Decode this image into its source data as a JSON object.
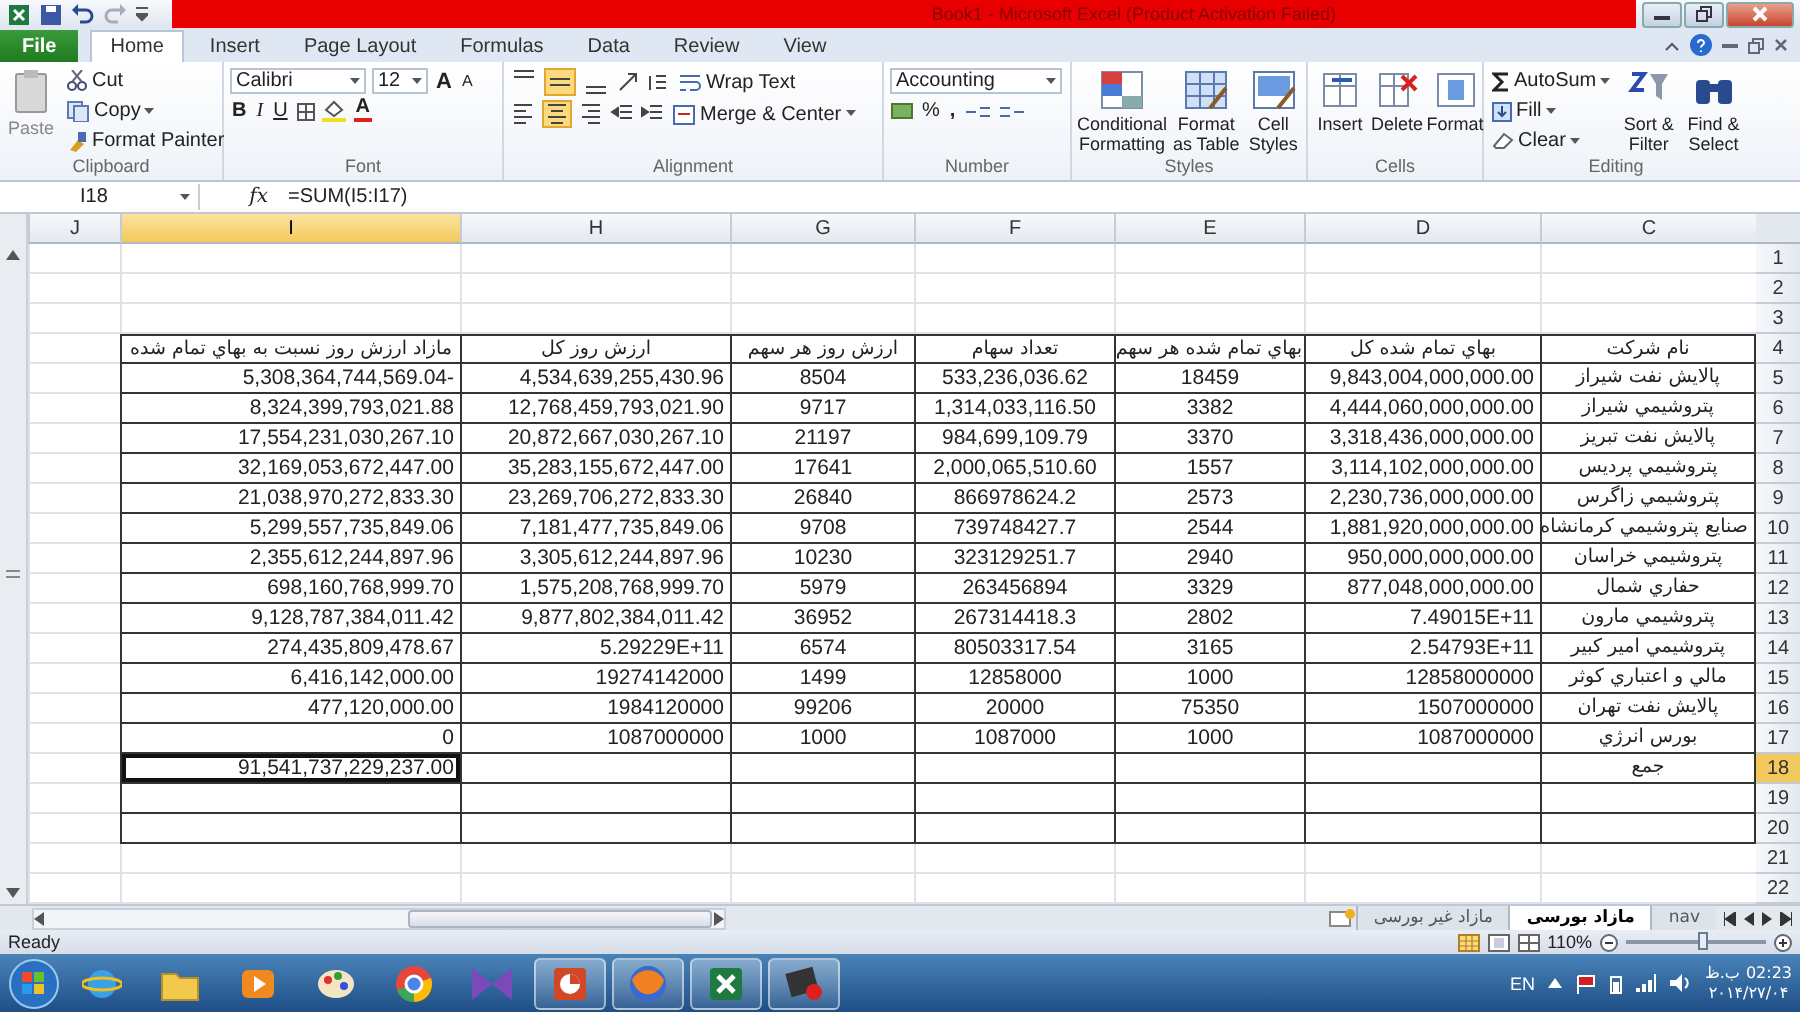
{
  "window": {
    "title": "Book1  -  Microsoft Excel (Product Activation Failed)"
  },
  "ribbon_tabs": [
    {
      "label": "File",
      "kind": "file",
      "selected": false
    },
    {
      "label": "Home",
      "kind": "tab",
      "selected": true
    },
    {
      "label": "Insert",
      "kind": "tab",
      "selected": false
    },
    {
      "label": "Page Layout",
      "kind": "tab",
      "selected": false
    },
    {
      "label": "Formulas",
      "kind": "tab",
      "selected": false
    },
    {
      "label": "Data",
      "kind": "tab",
      "selected": false
    },
    {
      "label": "Review",
      "kind": "tab",
      "selected": false
    },
    {
      "label": "View",
      "kind": "tab",
      "selected": false
    }
  ],
  "ribbon": {
    "clipboard": {
      "paste": "Paste",
      "cut": "Cut",
      "copy": "Copy",
      "format_painter": "Format Painter",
      "label": "Clipboard"
    },
    "font": {
      "font_name": "Calibri",
      "font_size": "12",
      "grow": "A",
      "shrink": "A",
      "bold": "B",
      "italic": "I",
      "underline": "U",
      "font_color": "A",
      "label": "Font"
    },
    "alignment": {
      "vertical": [
        {
          "selected": false
        },
        {
          "selected": true
        },
        {
          "selected": false
        }
      ],
      "horizontal": [
        {
          "selected": false
        },
        {
          "selected": true
        },
        {
          "selected": false
        }
      ],
      "wrap_text": "Wrap Text",
      "merge": "Merge & Center",
      "label": "Alignment"
    },
    "number": {
      "format": "Accounting",
      "percent": "%",
      "comma": ",",
      "label": "Number"
    },
    "styles": {
      "buttons": [
        "Conditional Formatting",
        "Format as Table",
        "Cell Styles"
      ],
      "label": "Styles"
    },
    "cells": {
      "buttons": [
        "Insert",
        "Delete",
        "Format"
      ],
      "label": "Cells"
    },
    "editing": {
      "autosum": "AutoSum",
      "fill": "Fill",
      "clear": "Clear",
      "buttons": [
        "Sort & Filter",
        "Find & Select"
      ],
      "label": "Editing"
    }
  },
  "formula_bar": {
    "name_box": "I18",
    "function_label": "fx",
    "formula": "=SUM(I5:I17)"
  },
  "sheet": {
    "columns": [
      {
        "label": "J",
        "selected": false
      },
      {
        "label": "I",
        "selected": true
      },
      {
        "label": "H",
        "selected": false
      },
      {
        "label": "G",
        "selected": false
      },
      {
        "label": "F",
        "selected": false
      },
      {
        "label": "E",
        "selected": false
      },
      {
        "label": "D",
        "selected": false
      },
      {
        "label": "C",
        "selected": false
      }
    ],
    "row_numbers": [
      {
        "label": "1",
        "selected": false
      },
      {
        "label": "2",
        "selected": false
      },
      {
        "label": "3",
        "selected": false
      },
      {
        "label": "4",
        "selected": false
      },
      {
        "label": "5",
        "selected": false
      },
      {
        "label": "6",
        "selected": false
      },
      {
        "label": "7",
        "selected": false
      },
      {
        "label": "8",
        "selected": false
      },
      {
        "label": "9",
        "selected": false
      },
      {
        "label": "10",
        "selected": false
      },
      {
        "label": "11",
        "selected": false
      },
      {
        "label": "12",
        "selected": false
      },
      {
        "label": "13",
        "selected": false
      },
      {
        "label": "14",
        "selected": false
      },
      {
        "label": "15",
        "selected": false
      },
      {
        "label": "16",
        "selected": false
      },
      {
        "label": "17",
        "selected": false
      },
      {
        "label": "18",
        "selected": true
      },
      {
        "label": "19",
        "selected": false
      },
      {
        "label": "20",
        "selected": false
      },
      {
        "label": "21",
        "selected": false
      },
      {
        "label": "22",
        "selected": false
      }
    ],
    "table": {
      "header": {
        "company": "نام شرکت",
        "total_cost": "بهاي تمام شده کل",
        "cost_per_share": "بهاي تمام شده هر سهم",
        "shares": "تعداد سهام",
        "value_per_share": "ارزش روز هر سهم",
        "total_value": "ارزش روز کل",
        "surplus": "مازاد ارزش روز نسبت به بهاي تمام شده"
      },
      "rows": [
        {
          "company": "پالایش نفت شیراز",
          "total_cost": "9,843,004,000,000.00",
          "cost_per_share": "18459",
          "shares": "533,236,036.62",
          "value_per_share": "8504",
          "total_value": "4,534,639,255,430.96",
          "surplus": "5,308,364,744,569.04-"
        },
        {
          "company": "پتروشیمي شیراز",
          "total_cost": "4,444,060,000,000.00",
          "cost_per_share": "3382",
          "shares": "1,314,033,116.50",
          "value_per_share": "9717",
          "total_value": "12,768,459,793,021.90",
          "surplus": "8,324,399,793,021.88"
        },
        {
          "company": "پالایش نفت تبریز",
          "total_cost": "3,318,436,000,000.00",
          "cost_per_share": "3370",
          "shares": "984,699,109.79",
          "value_per_share": "21197",
          "total_value": "20,872,667,030,267.10",
          "surplus": "17,554,231,030,267.10"
        },
        {
          "company": "پتروشیمي پردیس",
          "total_cost": "3,114,102,000,000.00",
          "cost_per_share": "1557",
          "shares": "2,000,065,510.60",
          "value_per_share": "17641",
          "total_value": "35,283,155,672,447.00",
          "surplus": "32,169,053,672,447.00"
        },
        {
          "company": "پتروشیمي زاگرس",
          "total_cost": "2,230,736,000,000.00",
          "cost_per_share": "2573",
          "shares": "866978624.2",
          "value_per_share": "26840",
          "total_value": "23,269,706,272,833.30",
          "surplus": "21,038,970,272,833.30"
        },
        {
          "company": "صنایع پتروشیمي کرمانشاه",
          "total_cost": "1,881,920,000,000.00",
          "cost_per_share": "2544",
          "shares": "739748427.7",
          "value_per_share": "9708",
          "total_value": "7,181,477,735,849.06",
          "surplus": "5,299,557,735,849.06"
        },
        {
          "company": "پتروشیمي خراسان",
          "total_cost": "950,000,000,000.00",
          "cost_per_share": "2940",
          "shares": "323129251.7",
          "value_per_share": "10230",
          "total_value": "3,305,612,244,897.96",
          "surplus": "2,355,612,244,897.96"
        },
        {
          "company": "حفاري شمال",
          "total_cost": "877,048,000,000.00",
          "cost_per_share": "3329",
          "shares": "263456894",
          "value_per_share": "5979",
          "total_value": "1,575,208,768,999.70",
          "surplus": "698,160,768,999.70"
        },
        {
          "company": "پتروشیمي مارون",
          "total_cost": "7.49015E+11",
          "cost_per_share": "2802",
          "shares": "267314418.3",
          "value_per_share": "36952",
          "total_value": "9,877,802,384,011.42",
          "surplus": "9,128,787,384,011.42"
        },
        {
          "company": "پتروشیمي امیر کبیر",
          "total_cost": "2.54793E+11",
          "cost_per_share": "3165",
          "shares": "80503317.54",
          "value_per_share": "6574",
          "total_value": "5.29229E+11",
          "surplus": "274,435,809,478.67"
        },
        {
          "company": "مالي و اعتباري کوثر",
          "total_cost": "12858000000",
          "cost_per_share": "1000",
          "shares": "12858000",
          "value_per_share": "1499",
          "total_value": "19274142000",
          "surplus": "6,416,142,000.00"
        },
        {
          "company": "پالایش نفت تهران",
          "total_cost": "1507000000",
          "cost_per_share": "75350",
          "shares": "20000",
          "value_per_share": "99206",
          "total_value": "1984120000",
          "surplus": "477,120,000.00"
        },
        {
          "company": "بورس انرژي",
          "total_cost": "1087000000",
          "cost_per_share": "1000",
          "shares": "1087000",
          "value_per_share": "1000",
          "total_value": "1087000000",
          "surplus": "0"
        }
      ],
      "total": {
        "label": "جمع",
        "value": "91,541,737,229,237.00"
      }
    }
  },
  "sheet_tabs": [
    {
      "label": "nav",
      "selected": false
    },
    {
      "label": "مازاد بورسی",
      "selected": true
    },
    {
      "label": "مازاد غیر بورسی",
      "selected": false
    }
  ],
  "status_bar": {
    "status": "Ready",
    "zoom": "110%",
    "zoom_slider": {
      "level": 0.55
    }
  },
  "taskbar": {
    "apps": [
      {
        "kind": "browser-e",
        "running": false
      },
      {
        "kind": "folder",
        "running": false
      },
      {
        "kind": "media",
        "running": false
      },
      {
        "kind": "palette",
        "running": false
      },
      {
        "kind": "chrome",
        "running": false
      },
      {
        "kind": "bowtie",
        "running": false
      },
      {
        "kind": "slides",
        "running": true
      },
      {
        "kind": "fox",
        "running": true
      },
      {
        "kind": "sheet",
        "running": true
      },
      {
        "kind": "record",
        "running": true
      }
    ],
    "language": "EN",
    "period": "ب.ظ",
    "time": "02:23",
    "date": "۲۰۱۴/۲۷/۰۴"
  }
}
